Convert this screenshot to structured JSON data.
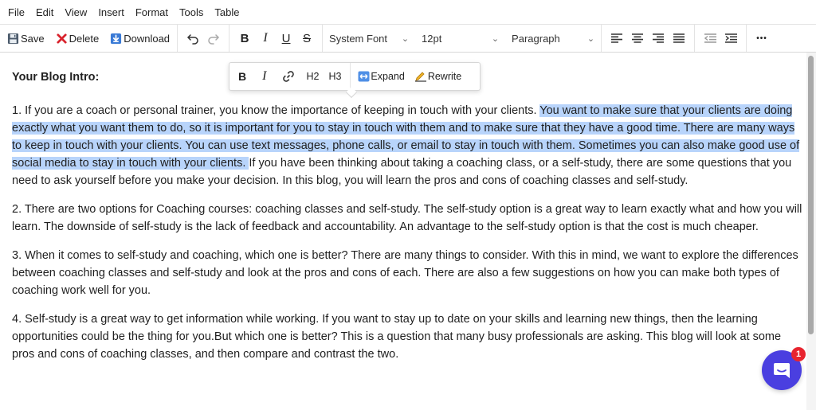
{
  "menu": {
    "items": [
      "File",
      "Edit",
      "View",
      "Insert",
      "Format",
      "Tools",
      "Table"
    ]
  },
  "toolbar": {
    "save_label": "Save",
    "delete_label": "Delete",
    "download_label": "Download",
    "bold_label": "B",
    "italic_label": "I",
    "underline_label": "U",
    "strike_label": "S",
    "font_family": "System Font",
    "font_size": "12pt",
    "block_format": "Paragraph",
    "more_label": "•••"
  },
  "float_toolbar": {
    "bold_label": "B",
    "italic_label": "I",
    "h2_label": "H2",
    "h3_label": "H3",
    "expand_label": "Expand",
    "rewrite_label": "Rewrite"
  },
  "editor": {
    "heading": "Your Blog Intro:",
    "p1_before": "1.  If you are a coach or personal trainer, you know the importance of keeping in touch with your clients. ",
    "p1_highlight": "You want to make sure that your clients are doing exactly what you want them to do, so it is important for you to stay in touch with them and to make sure that they have a good time. There are many ways to keep in touch with your clients. You can use text messages, phone calls, or email to stay in touch with them. Sometimes you can also make good use of social media to stay in touch with your clients. ",
    "p1_after": " If you have been thinking about taking a coaching class, or a self-study, there are some questions that you need to ask yourself before you make your decision. In this blog, you will learn the pros and cons of coaching classes and self-study.",
    "p2": "2. There are two options for  Coaching courses: coaching classes and self-study. The self-study option is a great way to learn exactly what and how you will learn. The downside of self-study is the lack of feedback and accountability. An advantage to the self-study option is that the cost is much cheaper.",
    "p3": "3. When it comes to self-study and coaching, which one is better? There are many things to consider. With this in mind, we want to explore the differences between coaching classes and self-study and look at the pros and cons of each. There are also a few suggestions on how you can make both types of coaching work well for you.",
    "p4": "4. Self-study is a great way to get information while working. If you want to stay up to date on your skills and learning new things, then the learning opportunities could be the thing for you.But which one is better? This is a question that many busy professionals are asking. This blog will look at some pros and cons of coaching classes, and then compare and contrast the two."
  },
  "chat": {
    "badge_count": "1"
  },
  "colors": {
    "highlight": "#b8d4fb",
    "chat_button": "#4a3fe0",
    "badge": "#e8242f",
    "delete_icon": "#d9232d",
    "download_icon": "#3b7bd6"
  }
}
